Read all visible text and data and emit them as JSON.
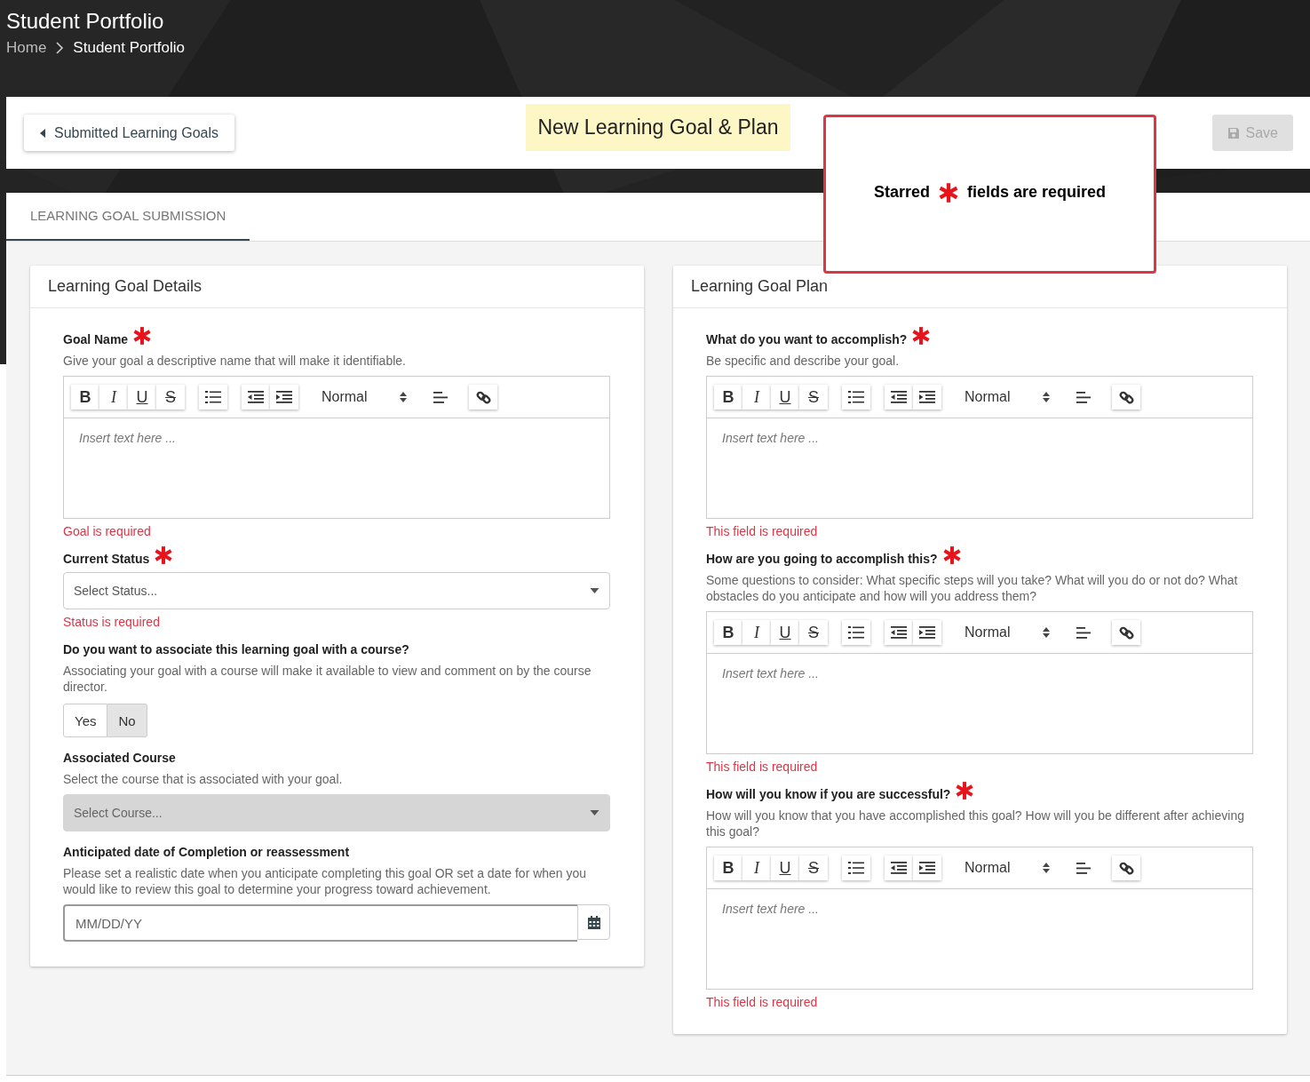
{
  "header": {
    "title": "Student Portfolio",
    "breadcrumb": [
      {
        "label": "Home",
        "current": false
      },
      {
        "label": "Student Portfolio",
        "current": true
      }
    ]
  },
  "toolbar": {
    "back_button": "Submitted Learning Goals",
    "title": "New Learning Goal & Plan",
    "save_button": {
      "label": "Save",
      "disabled": true
    }
  },
  "tabs": [
    {
      "label": "LEARNING GOAL SUBMISSION",
      "selected": true
    }
  ],
  "callout": {
    "before": "Starred",
    "after": "fields are required"
  },
  "panels": [
    {
      "title": "Learning Goal Details",
      "fields": [
        {
          "kind": "editor",
          "label": "Goal Name",
          "required": true,
          "help": "Give your goal a descriptive name that will make it identifiable.",
          "toolbar": [
            "B",
            "I",
            "U",
            "S"
          ],
          "style": "Normal",
          "placeholder": "Insert text here ...",
          "error": "Goal is required"
        },
        {
          "kind": "select",
          "label": "Current Status",
          "required": true,
          "placeholder": "Select Status...",
          "disabled": false,
          "error": "Status is required"
        },
        {
          "kind": "toggle",
          "label": "Do you want to associate this learning goal with a course?",
          "help": "Associating your goal with a course will make it available to view and comment on by the course director.",
          "options": [
            {
              "label": "Yes",
              "selected": false
            },
            {
              "label": "No",
              "selected": true
            }
          ]
        },
        {
          "kind": "select",
          "label": "Associated Course",
          "help": "Select the course that is associated with your goal.",
          "placeholder": "Select Course...",
          "disabled": true
        },
        {
          "kind": "date",
          "label": "Anticipated date of Completion or reassessment",
          "help": "Please set a realistic date when you anticipate completing this goal OR set a date for when you would like to review this goal to determine your progress toward achievement.",
          "placeholder": "MM/DD/YY"
        }
      ]
    },
    {
      "title": "Learning Goal Plan",
      "fields": [
        {
          "kind": "editor",
          "label": "What do you want to accomplish?",
          "required": true,
          "help": "Be specific and describe your goal.",
          "toolbar": [
            "B",
            "I",
            "U",
            "S"
          ],
          "style": "Normal",
          "placeholder": "Insert text here ...",
          "error": "This field is required"
        },
        {
          "kind": "editor",
          "label": "How are you going to accomplish this?",
          "required": true,
          "help": "Some questions to consider: What specific steps will you take? What will you do or not do? What obstacles do you anticipate and how will you address them?",
          "toolbar": [
            "B",
            "I",
            "U",
            "S"
          ],
          "style": "Normal",
          "placeholder": "Insert text here ...",
          "error": "This field is required"
        },
        {
          "kind": "editor",
          "label": "How will you know if you are successful?",
          "required": true,
          "help": "How will you know that you have accomplished this goal? How will you be different after achieving this goal?",
          "toolbar": [
            "B",
            "I",
            "U",
            "S"
          ],
          "style": "Normal",
          "placeholder": "Insert text here ...",
          "error": "This field is required"
        }
      ]
    }
  ]
}
